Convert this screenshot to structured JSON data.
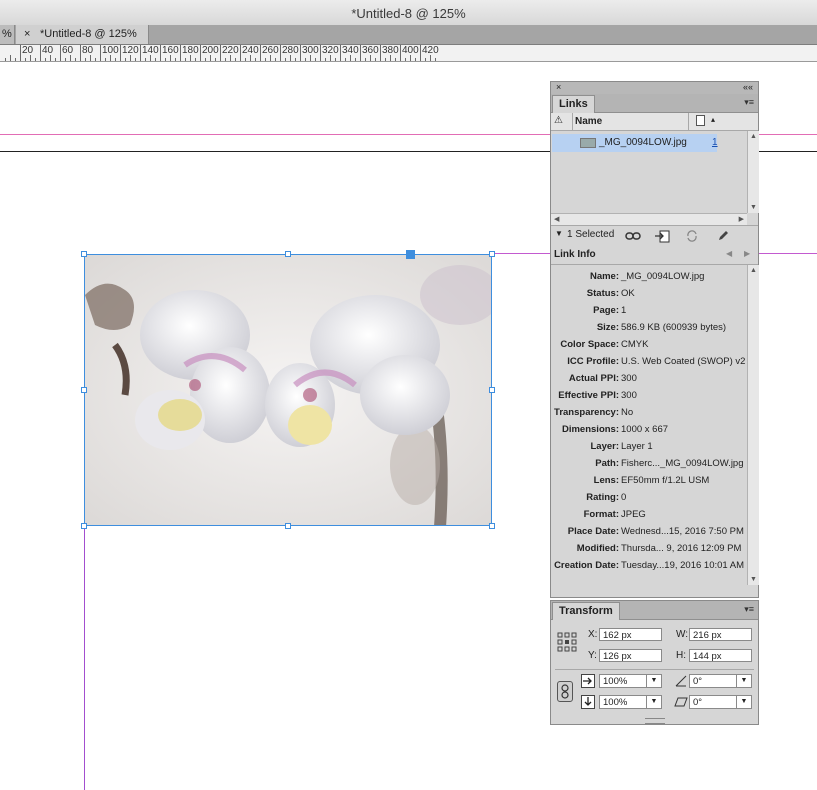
{
  "window": {
    "title": "*Untitled-8 @ 125%"
  },
  "tabs": {
    "previous_label": "%",
    "close_glyph": "×",
    "active_label": "*Untitled-8 @ 125%"
  },
  "ruler": {
    "labels": [
      "20",
      "40",
      "60",
      "80",
      "100",
      "120",
      "140",
      "160",
      "180",
      "200",
      "220",
      "240",
      "260",
      "280",
      "300",
      "320",
      "340",
      "360",
      "380",
      "400",
      "420"
    ]
  },
  "links_panel": {
    "close_glyph": "×",
    "collapse_glyph": "««",
    "tab_label": "Links",
    "menu_glyph": "▾≡",
    "warning_glyph": "⚠",
    "column_name": "Name",
    "sort_glyph": "▴",
    "file_row": {
      "name": "_MG_0094LOW.jpg",
      "page": "1"
    },
    "selected_text": "1 Selected",
    "link_info_label": "Link Info",
    "link_info": [
      {
        "key": "Name:",
        "value": "_MG_0094LOW.jpg"
      },
      {
        "key": "Status:",
        "value": "OK"
      },
      {
        "key": "Page:",
        "value": "1"
      },
      {
        "key": "Size:",
        "value": "586.9 KB (600939 bytes)"
      },
      {
        "key": "Color Space:",
        "value": "CMYK"
      },
      {
        "key": "ICC Profile:",
        "value": "U.S. Web Coated (SWOP) v2"
      },
      {
        "key": "Actual PPI:",
        "value": "300"
      },
      {
        "key": "Effective PPI:",
        "value": "300"
      },
      {
        "key": "Transparency:",
        "value": "No"
      },
      {
        "key": "Dimensions:",
        "value": "1000 x 667"
      },
      {
        "key": "Layer:",
        "value": "Layer 1"
      },
      {
        "key": "Path:",
        "value": "Fisherc..._MG_0094LOW.jpg"
      },
      {
        "key": "Lens:",
        "value": "EF50mm f/1.2L USM"
      },
      {
        "key": "Rating:",
        "value": "0"
      },
      {
        "key": "Format:",
        "value": "JPEG"
      },
      {
        "key": "Place Date:",
        "value": "Wednesd...15, 2016 7:50 PM"
      },
      {
        "key": "Modified:",
        "value": "Thursda... 9, 2016 12:09 PM"
      },
      {
        "key": "Creation Date:",
        "value": "Tuesday...19, 2016 10:01 AM"
      }
    ]
  },
  "transform_panel": {
    "tab_label": "Transform",
    "menu_glyph": "▾≡",
    "x_label": "X:",
    "x_value": "162 px",
    "y_label": "Y:",
    "y_value": "126 px",
    "w_label": "W:",
    "w_value": "216 px",
    "h_label": "H:",
    "h_value": "144 px",
    "scale_x": "100%",
    "scale_y": "100%",
    "rotation": "0°",
    "shear": "0°",
    "dropdown_glyph": "▼"
  },
  "colors": {
    "accent": "#3e8ede",
    "selection": "#b7d1f2",
    "guide_pink": "#e26db5",
    "guide_purple": "#a34ecf"
  }
}
